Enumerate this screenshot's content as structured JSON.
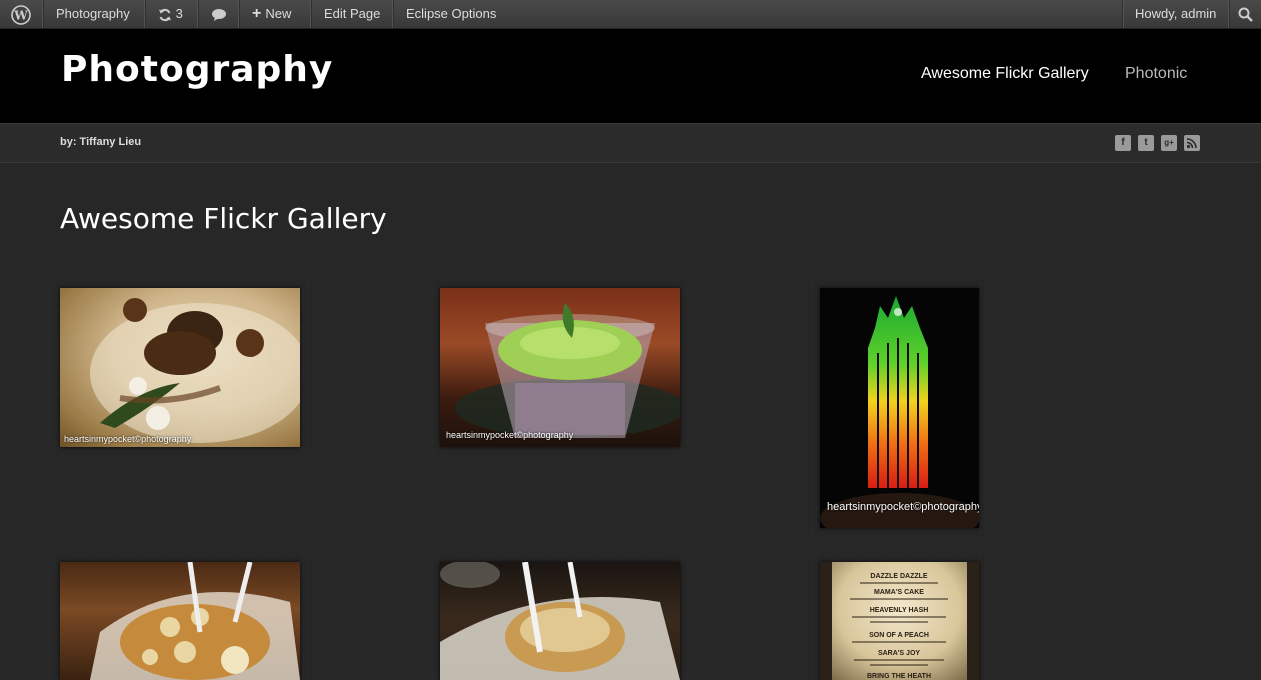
{
  "adminbar": {
    "site_name": "Photography",
    "updates_count": "3",
    "new_label": "New",
    "edit_label": "Edit Page",
    "options_label": "Eclipse Options",
    "howdy": "Howdy, admin"
  },
  "header": {
    "site_title": "Photography",
    "nav": [
      "Awesome Flickr Gallery",
      "Photonic"
    ]
  },
  "subbar": {
    "byline": "by: Tiffany Lieu",
    "social": [
      "facebook-icon",
      "twitter-icon",
      "google-plus-icon",
      "rss-icon"
    ]
  },
  "main": {
    "title": "Awesome Flickr Gallery",
    "watermark": "heartsinmypocket©photography"
  },
  "colors": {
    "background": "#262626",
    "header": "#000000",
    "adminbar": "#3f3f3f"
  }
}
